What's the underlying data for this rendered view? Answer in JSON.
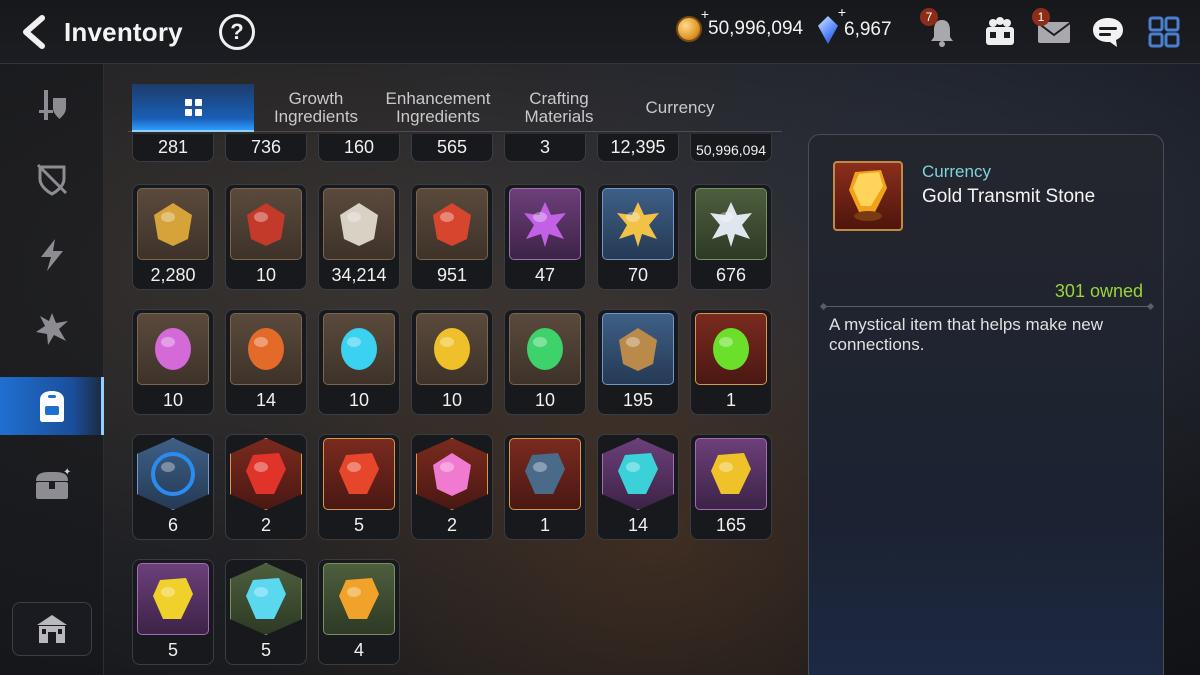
{
  "header": {
    "title": "Inventory",
    "help": "?",
    "gold": "50,996,094",
    "crystals": "6,967",
    "notification_badge": "7",
    "mail_badge": "1"
  },
  "sidebar": {
    "items": [
      {
        "icon": "sword-shield-icon"
      },
      {
        "icon": "broken-shield-icon"
      },
      {
        "icon": "lightning-icon"
      },
      {
        "icon": "rune-shard-icon"
      },
      {
        "icon": "backpack-icon",
        "active": true
      },
      {
        "icon": "treasure-chest-icon"
      }
    ],
    "bottom_icon": "guild-hall-icon"
  },
  "tabs": [
    {
      "label": "",
      "icon": "grid-icon",
      "active": true
    },
    {
      "label": "Growth\nIngredients"
    },
    {
      "label": "Enhancement\nIngredients"
    },
    {
      "label": "Crafting\nMaterials"
    },
    {
      "label": "Currency"
    }
  ],
  "inventory": {
    "top_row_counts": [
      "281",
      "736",
      "160",
      "565",
      "3",
      "12,395",
      "50,996,094"
    ],
    "rows": [
      [
        {
          "icon": "fist-emblem-icon",
          "count": "2,280",
          "frame": "brown"
        },
        {
          "icon": "war-banner-icon",
          "count": "10",
          "frame": "brown"
        },
        {
          "icon": "chess-knight-icon",
          "count": "34,214",
          "frame": "brown"
        },
        {
          "icon": "red-leaf-icon",
          "count": "951",
          "frame": "brown"
        },
        {
          "icon": "purple-flower-icon",
          "count": "47",
          "frame": "purple"
        },
        {
          "icon": "gold-flower-icon",
          "count": "70",
          "frame": "blue"
        },
        {
          "icon": "silver-flower-icon",
          "count": "676",
          "frame": "green"
        }
      ],
      [
        {
          "icon": "pink-rune-icon",
          "count": "10",
          "frame": "brown"
        },
        {
          "icon": "orange-rune-icon",
          "count": "14",
          "frame": "brown"
        },
        {
          "icon": "cyan-rune-icon",
          "count": "10",
          "frame": "brown"
        },
        {
          "icon": "yellow-rune-icon",
          "count": "10",
          "frame": "brown"
        },
        {
          "icon": "green-rune-icon",
          "count": "10",
          "frame": "brown"
        },
        {
          "icon": "root-herb-icon",
          "count": "195",
          "frame": "blue"
        },
        {
          "icon": "green-orb-icon",
          "count": "1",
          "frame": "red"
        }
      ],
      [
        {
          "icon": "blue-sigil-icon",
          "count": "6",
          "frame": "blue-hex"
        },
        {
          "icon": "red-charm-icon",
          "count": "2",
          "frame": "red-hex"
        },
        {
          "icon": "red-hammer-stone-icon",
          "count": "5",
          "frame": "red"
        },
        {
          "icon": "pink-potion-icon",
          "count": "2",
          "frame": "red-hex"
        },
        {
          "icon": "blue-rune-stone-icon",
          "count": "1",
          "frame": "red"
        },
        {
          "icon": "cyan-charm-icon",
          "count": "14",
          "frame": "purple-hex"
        },
        {
          "icon": "yellow-hammer-stone-icon",
          "count": "165",
          "frame": "purple"
        }
      ],
      [
        {
          "icon": "yellow-bolt-stone-icon",
          "count": "5",
          "frame": "purple"
        },
        {
          "icon": "cyan-star-stone-icon",
          "count": "5",
          "frame": "green-hex"
        },
        {
          "icon": "orange-hammer-stone-icon",
          "count": "4",
          "frame": "green"
        }
      ]
    ]
  },
  "detail": {
    "category": "Currency",
    "name": "Gold Transmit Stone",
    "owned": "301 owned",
    "description": "A mystical item that helps make new connections."
  },
  "colors": {
    "accent_blue": "#1f6fd0",
    "owned_green": "#9bd43a",
    "category_teal": "#7fd3d8"
  }
}
